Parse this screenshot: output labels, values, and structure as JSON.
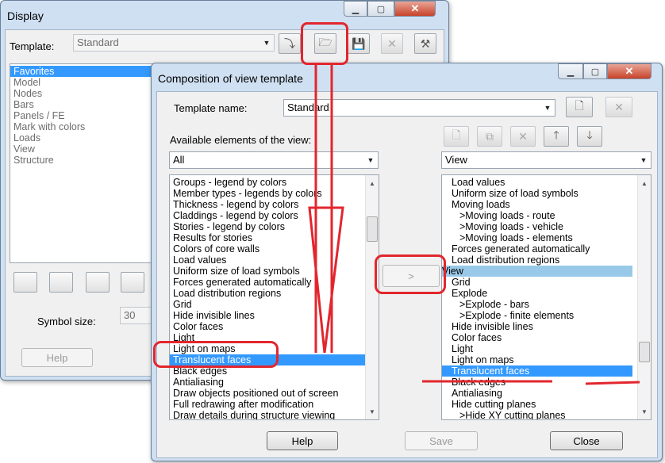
{
  "display": {
    "title": "Display",
    "template_label": "Template:",
    "template_value": "Standard",
    "list_items": [
      "Favorites",
      "Model",
      "Nodes",
      "Bars",
      "Panels / FE",
      "Mark with colors",
      "Loads",
      "View",
      "Structure"
    ],
    "symbol_size_label": "Symbol size:",
    "symbol_size_value": "30",
    "help_label": "Help"
  },
  "dialog": {
    "title": "Composition of view template",
    "template_name_label": "Template name:",
    "template_name_value": "Standard",
    "available_label": "Available elements of the view:",
    "left_filter": "All",
    "right_filter": "View",
    "transfer_label": ">",
    "left_items": [
      "Groups - legend by colors",
      "Member types - legends by colors",
      "Thickness - legend by colors",
      "Claddings - legend by colors",
      "Stories - legend by colors",
      "Results for stories",
      "Colors of core walls",
      "Load values",
      "Uniform size of load symbols",
      "Forces generated automatically",
      "Load distribution regions",
      "Grid",
      "Hide invisible lines",
      "Color faces",
      "Light",
      "Light on maps",
      "Translucent faces",
      "Black edges",
      "Antialiasing",
      "Draw objects positioned out of screen",
      "Full redrawing after modification",
      "Draw details during structure viewing"
    ],
    "right_items": [
      "Load values",
      "Uniform size of load symbols",
      "Moving loads",
      ">Moving loads - route",
      ">Moving loads - vehicle",
      ">Moving loads - elements",
      "Forces generated automatically",
      "Load distribution regions",
      "View",
      "Grid",
      "Explode",
      ">Explode - bars",
      ">Explode - finite elements",
      "Hide invisible lines",
      "Color faces",
      "Light",
      "Light on maps",
      "Translucent faces",
      "Black edges",
      "Antialiasing",
      "Hide cutting planes",
      ">Hide XY cutting planes"
    ],
    "help_label": "Help",
    "save_label": "Save",
    "close_label": "Close"
  },
  "colors": {
    "selection": "#3399ff",
    "header_selection": "#99c9e8",
    "annotation": "#e2262e"
  }
}
